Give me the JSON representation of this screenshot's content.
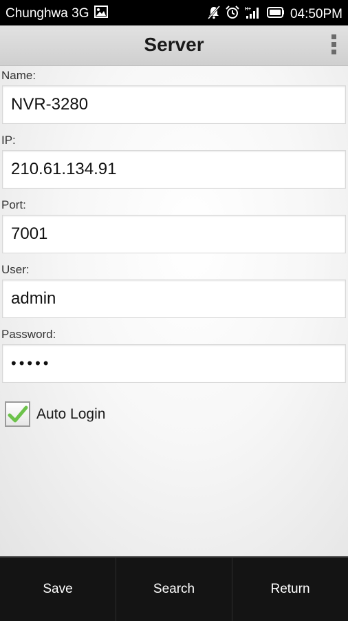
{
  "status_bar": {
    "carrier": "Chunghwa 3G",
    "time": "04:50PM",
    "icons": [
      "image-notification-icon",
      "muted-bell-icon",
      "alarm-clock-icon",
      "hplus-signal-icon",
      "battery-icon"
    ]
  },
  "action_bar": {
    "title": "Server",
    "overflow_icon": "overflow-menu-icon"
  },
  "form": {
    "name": {
      "label": "Name:",
      "value": "NVR-3280"
    },
    "ip": {
      "label": "IP:",
      "value": "210.61.134.91"
    },
    "port": {
      "label": "Port:",
      "value": "7001"
    },
    "user": {
      "label": "User:",
      "value": "admin"
    },
    "password": {
      "label": "Password:",
      "value": "•••••"
    },
    "auto_login": {
      "label": "Auto Login",
      "checked": true
    }
  },
  "bottom_bar": {
    "save": "Save",
    "search": "Search",
    "return": "Return"
  },
  "colors": {
    "status_bar_bg": "#000000",
    "action_bar_bg": "#d6d6d6",
    "bottom_bar_bg": "#141414",
    "check_green": "#6cc24a"
  }
}
